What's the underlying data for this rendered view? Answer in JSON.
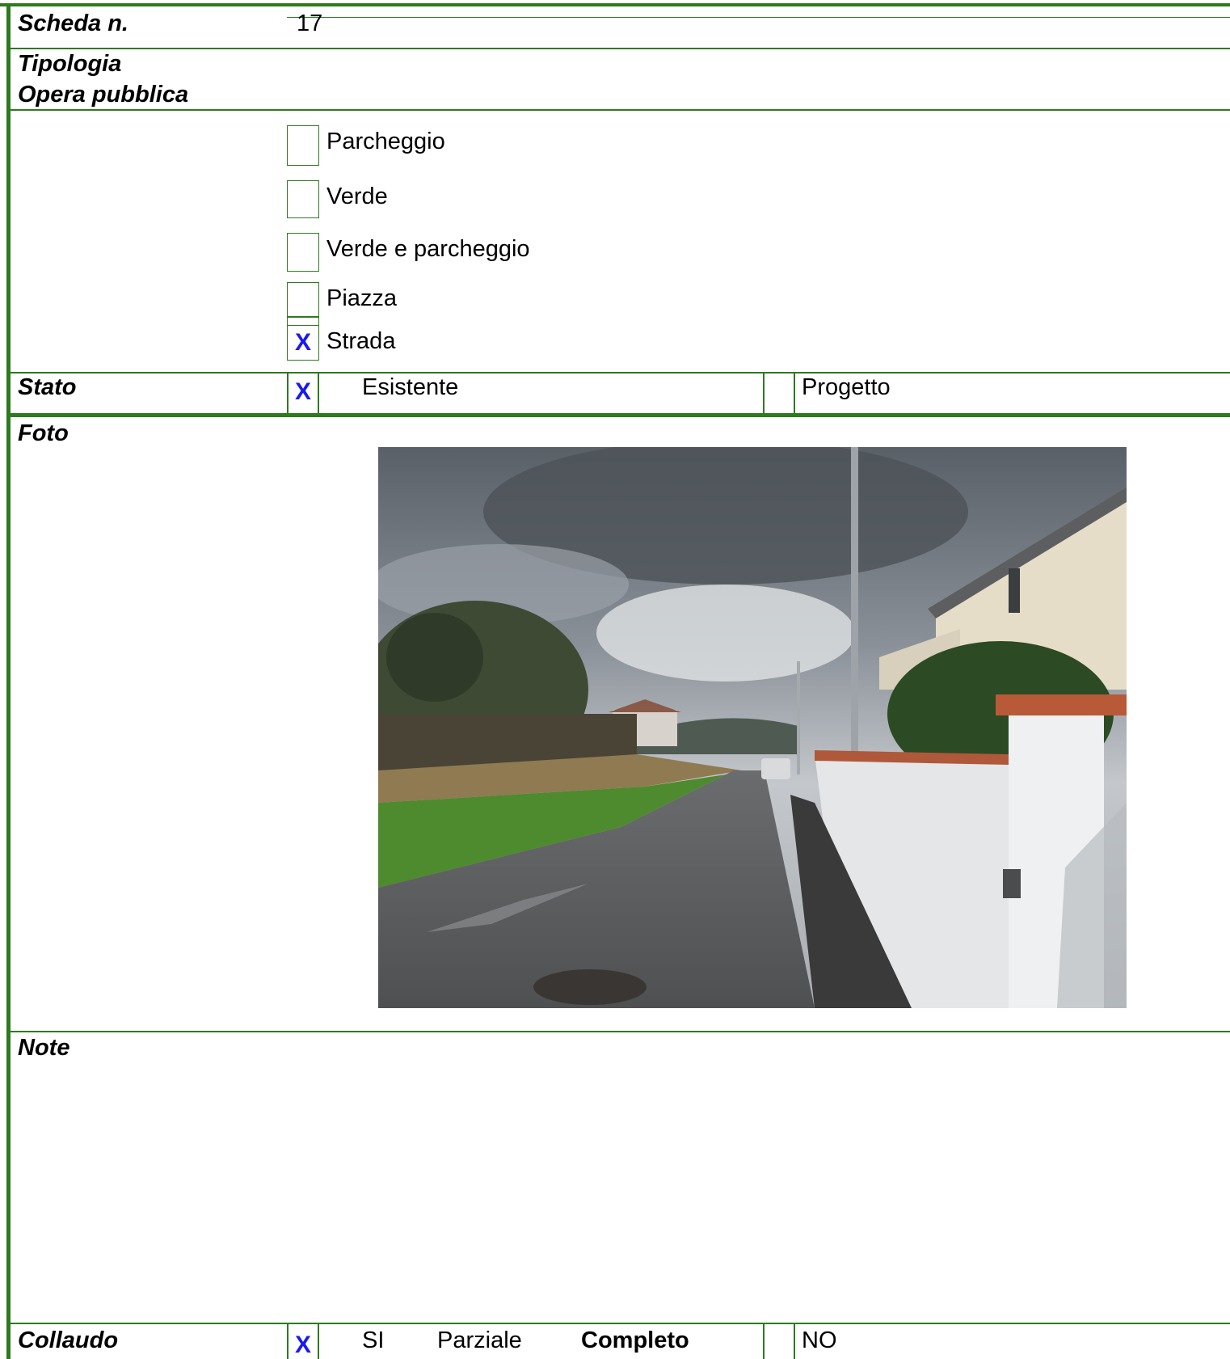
{
  "header": {
    "scheda_label": "Scheda n.",
    "scheda_value": "17"
  },
  "tipologia": {
    "label_line1": "Tipologia",
    "label_line2": "Opera pubblica",
    "options": [
      {
        "label": "Parcheggio",
        "mark": ""
      },
      {
        "label": "Verde",
        "mark": ""
      },
      {
        "label": "Verde e parcheggio",
        "mark": ""
      },
      {
        "label": "Piazza",
        "mark": ""
      },
      {
        "label": "Strada",
        "mark": "X"
      }
    ]
  },
  "stato": {
    "label": "Stato",
    "esistente_mark": "X",
    "esistente_label": "Esistente",
    "progetto_mark": "",
    "progetto_label": "Progetto"
  },
  "foto": {
    "label": "Foto",
    "photo_icon": "street-photo"
  },
  "note": {
    "label": "Note",
    "text": ""
  },
  "collaudo": {
    "label": "Collaudo",
    "si_mark": "X",
    "si_label": "SI",
    "parziale_label": "Parziale",
    "completo_label": "Completo",
    "no_mark": "",
    "no_label": "NO"
  },
  "colors": {
    "border": "#2d7a1f",
    "mark": "#1a1aee"
  }
}
